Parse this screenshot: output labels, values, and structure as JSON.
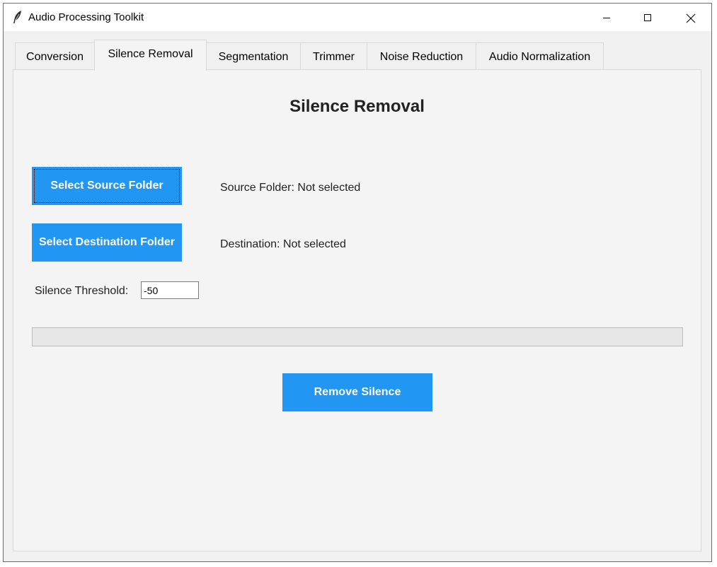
{
  "window": {
    "title": "Audio Processing Toolkit",
    "icons": {
      "app": "feather-icon",
      "minimize": "minimize-icon",
      "maximize": "maximize-icon",
      "close": "close-icon"
    }
  },
  "tabs": [
    {
      "label": "Conversion",
      "active": false
    },
    {
      "label": "Silence Removal",
      "active": true
    },
    {
      "label": "Segmentation",
      "active": false
    },
    {
      "label": "Trimmer",
      "active": false
    },
    {
      "label": "Noise Reduction",
      "active": false
    },
    {
      "label": "Audio Normalization",
      "active": false
    }
  ],
  "panel": {
    "title": "Silence Removal",
    "source_button_label": "Select Source Folder",
    "source_status": "Source Folder: Not selected",
    "dest_button_label": "Select Destination Folder",
    "dest_status": "Destination: Not selected",
    "threshold_label": "Silence Threshold:",
    "threshold_value": "-50",
    "progress_fraction": 0,
    "action_button_label": "Remove Silence"
  },
  "colors": {
    "accent": "#2196f3",
    "panel_background": "#f4f4f4",
    "window_background": "#f0f0f0"
  }
}
